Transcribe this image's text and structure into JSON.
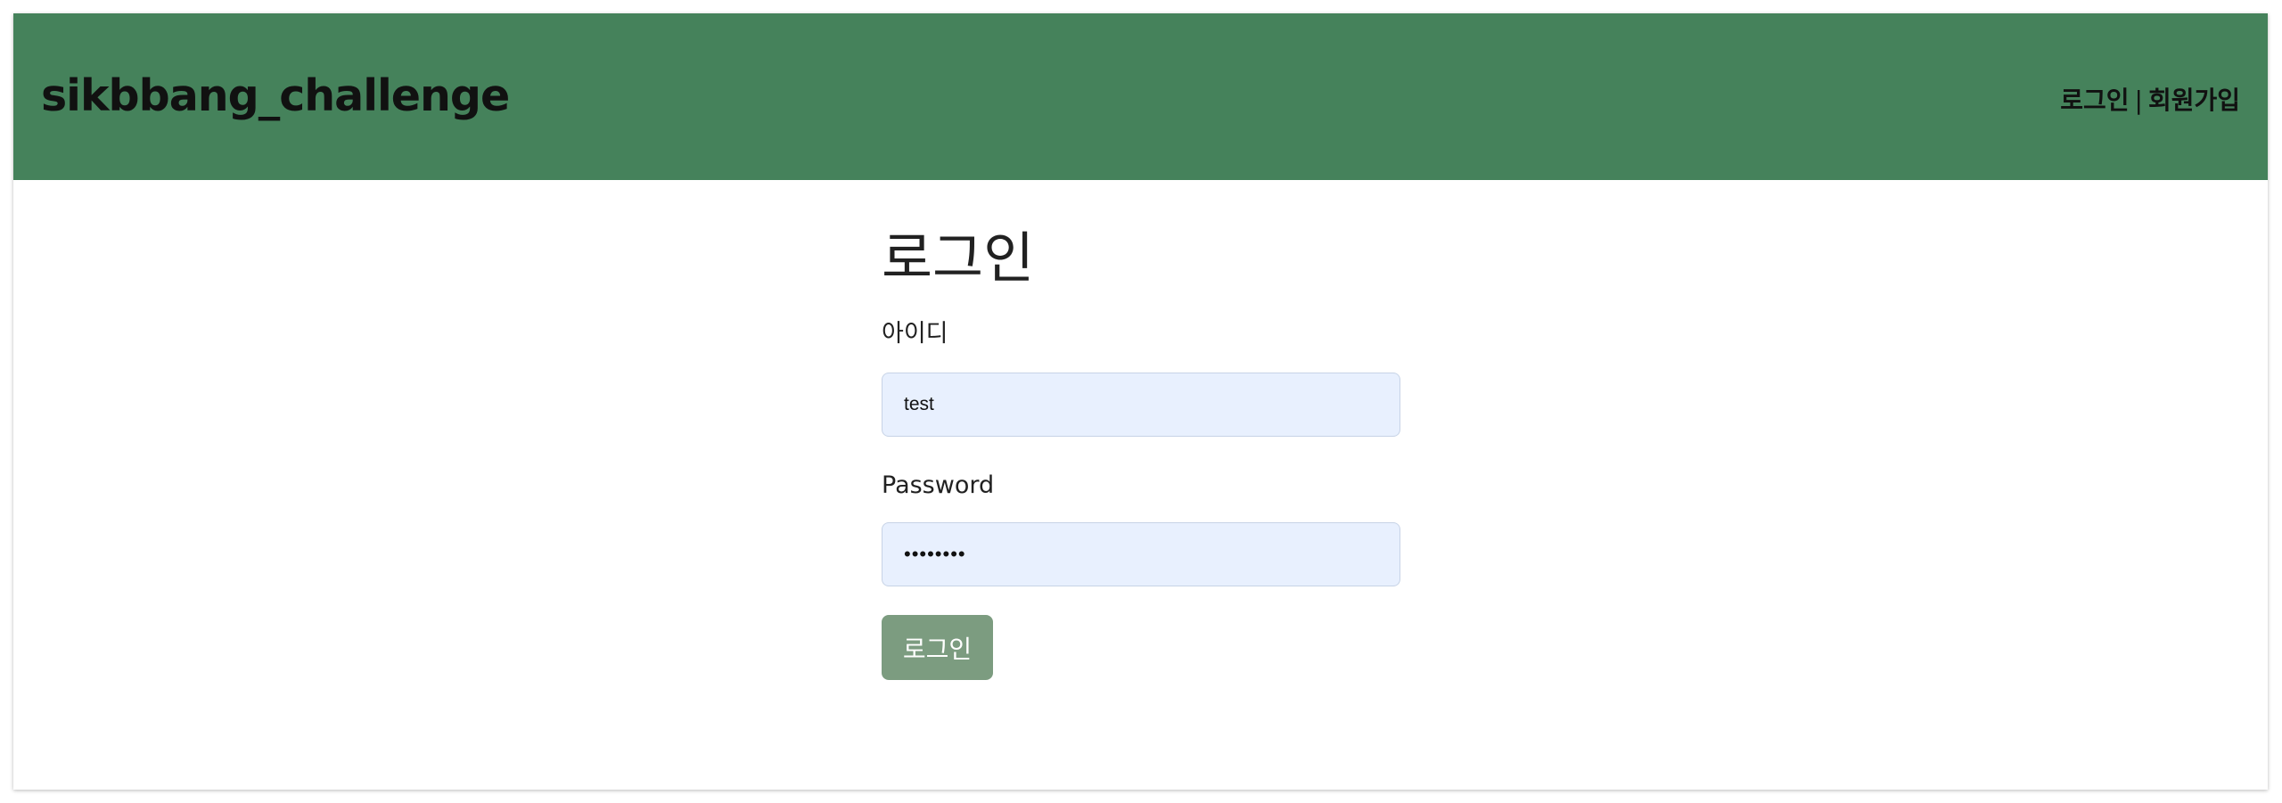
{
  "header": {
    "brand": "sikbbang_challenge",
    "nav": {
      "login": "로그인",
      "separator": "|",
      "signup": "회원가입"
    }
  },
  "main": {
    "title": "로그인",
    "id_label": "아이디",
    "id_value": "test",
    "password_label": "Password",
    "password_value": "••••••••",
    "submit_label": "로그인"
  },
  "colors": {
    "header_bg": "#45825b",
    "input_bg": "#e8f0fe",
    "button_bg": "#7c9c80"
  }
}
